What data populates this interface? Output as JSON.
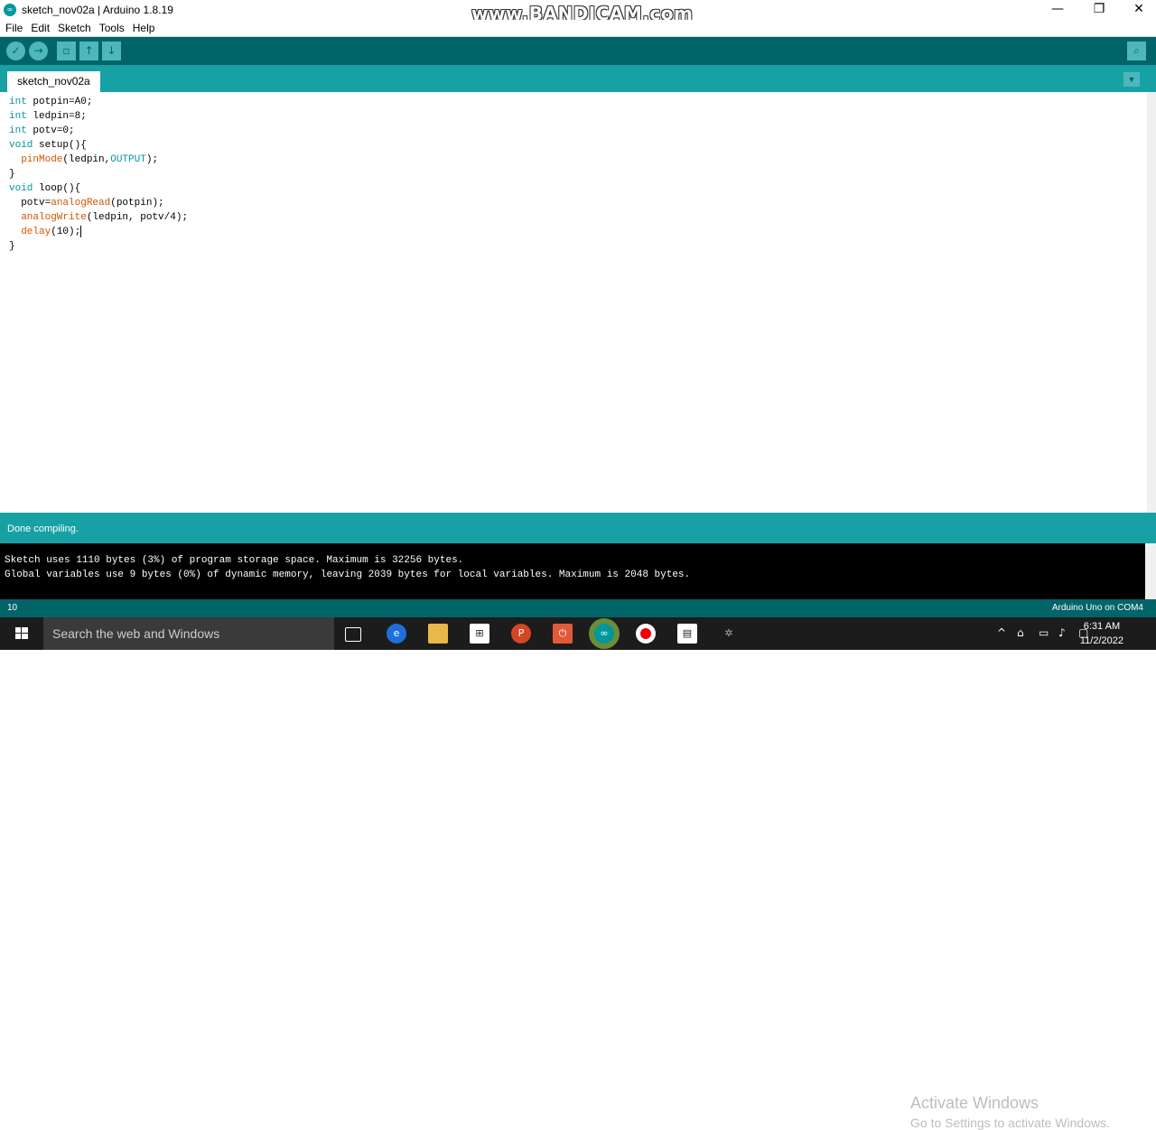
{
  "window": {
    "title": "sketch_nov02a | Arduino 1.8.19",
    "watermark": "www.BANDICAM.com",
    "minimize": "—",
    "restore": "❐",
    "close": "✕"
  },
  "menu": [
    "File",
    "Edit",
    "Sketch",
    "Tools",
    "Help"
  ],
  "toolbar": {
    "icons": [
      "verify-icon",
      "upload-icon",
      "new-icon",
      "open-icon",
      "save-icon",
      "serial-monitor-icon"
    ]
  },
  "tab": {
    "label": "sketch_nov02a"
  },
  "code": {
    "l1_kw": "int",
    "l1_rest": " potpin=A0;",
    "l2_kw": "int",
    "l2_rest": " ledpin=8;",
    "l3_kw": "int",
    "l3_rest": " potv=0;",
    "l4_kw": "void",
    "l4_rest": " setup(){",
    "l5_indent": "  ",
    "l5_fn": "pinMode",
    "l5_mid": "(ledpin,",
    "l5_cst": "OUTPUT",
    "l5_end": ");",
    "l6": "}",
    "l7_kw": "void",
    "l7_rest": " loop(){",
    "l8_a": "  potv=",
    "l8_fn": "analogRead",
    "l8_end": "(potpin);",
    "l9_indent": "  ",
    "l9_fn": "analogWrite",
    "l9_end": "(ledpin, potv/4);",
    "l10_indent": "  ",
    "l10_fn": "delay",
    "l10_end": "(10);",
    "l11": "}"
  },
  "status": {
    "message": "Done compiling."
  },
  "console": {
    "line1": "Sketch uses 1110 bytes (3%) of program storage space. Maximum is 32256 bytes.",
    "line2": "Global variables use 9 bytes (0%) of dynamic memory, leaving 2039 bytes for local variables. Maximum is 2048 bytes."
  },
  "activation": {
    "title": "Activate Windows",
    "subtitle": "Go to Settings to activate Windows."
  },
  "bottom": {
    "line": "10",
    "board": "Arduino Uno on COM4"
  },
  "taskbar": {
    "search_placeholder": "Search the web and Windows",
    "time": "6:31 AM",
    "date": "11/2/2022"
  },
  "colors": {
    "teal_dark": "#006468",
    "teal": "#17a1a5",
    "keyword": "#00979c",
    "function": "#d35400"
  }
}
